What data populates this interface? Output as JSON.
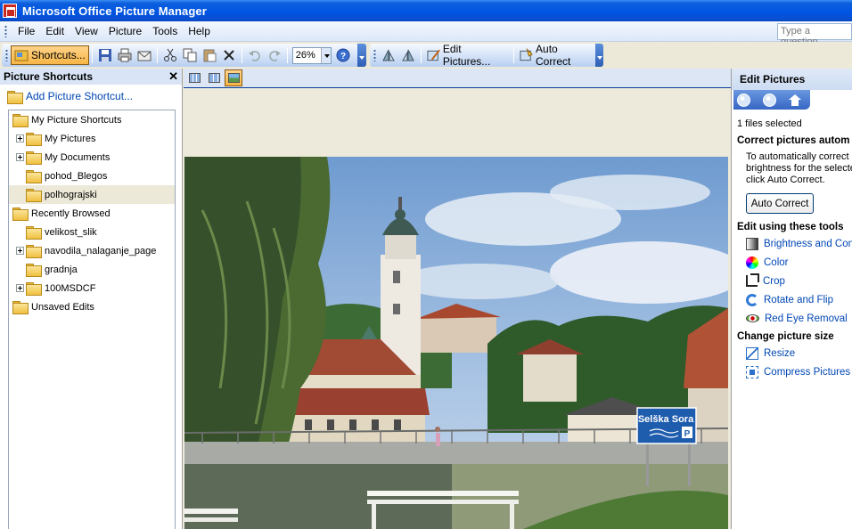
{
  "window": {
    "title": "Microsoft Office Picture Manager"
  },
  "menu": {
    "items": [
      {
        "key": "file",
        "label": "File"
      },
      {
        "key": "edit",
        "label": "Edit"
      },
      {
        "key": "view",
        "label": "View"
      },
      {
        "key": "picture",
        "label": "Picture"
      },
      {
        "key": "tools",
        "label": "Tools"
      },
      {
        "key": "help",
        "label": "Help"
      }
    ],
    "ask_placeholder": "Type a question"
  },
  "toolbar": {
    "shortcuts_label": "Shortcuts...",
    "zoom_value": "26%",
    "edit_pictures_label": "Edit Pictures...",
    "auto_correct_label": "Auto Correct"
  },
  "left_pane": {
    "title": "Picture Shortcuts",
    "add_shortcut": "Add Picture Shortcut...",
    "tree": [
      {
        "label": "My Picture Shortcuts",
        "level": 0,
        "expander": false,
        "selected": false
      },
      {
        "label": "My Pictures",
        "level": 1,
        "expander": true,
        "selected": false
      },
      {
        "label": "My Documents",
        "level": 1,
        "expander": true,
        "selected": false
      },
      {
        "label": "pohod_Blegos",
        "level": 1,
        "expander": false,
        "selected": false
      },
      {
        "label": "polhograjski",
        "level": 1,
        "expander": false,
        "selected": true
      },
      {
        "label": "Recently Browsed",
        "level": 0,
        "expander": false,
        "selected": false
      },
      {
        "label": "velikost_slik",
        "level": 1,
        "expander": false,
        "selected": false
      },
      {
        "label": "navodila_nalaganje_page",
        "level": 1,
        "expander": true,
        "selected": false
      },
      {
        "label": "gradnja",
        "level": 1,
        "expander": false,
        "selected": false
      },
      {
        "label": "100MSDCF",
        "level": 1,
        "expander": true,
        "selected": false
      },
      {
        "label": "Unsaved Edits",
        "level": 0,
        "expander": false,
        "selected": false
      }
    ]
  },
  "photo": {
    "sign_text": "Selška Sora",
    "sign_letter": "P"
  },
  "right_pane": {
    "title": "Edit Pictures",
    "files_selected": "1 files selected",
    "section_auto": "Correct pictures autom",
    "auto_desc_1": "To automatically correct c",
    "auto_desc_2": "brightness for the selecte",
    "auto_desc_3": "click Auto Correct.",
    "auto_button": "Auto Correct",
    "section_tools": "Edit using these tools",
    "tools": [
      {
        "label": "Brightness and Contr",
        "icon": "brightness-icon"
      },
      {
        "label": "Color",
        "icon": "color-icon"
      },
      {
        "label": "Crop",
        "icon": "crop-icon"
      },
      {
        "label": "Rotate and Flip",
        "icon": "rotate-icon"
      },
      {
        "label": "Red Eye Removal",
        "icon": "red-eye-icon"
      }
    ],
    "section_size": "Change picture size",
    "size_tools": [
      {
        "label": "Resize",
        "icon": "resize-icon"
      },
      {
        "label": "Compress Pictures",
        "icon": "compress-icon"
      }
    ]
  }
}
